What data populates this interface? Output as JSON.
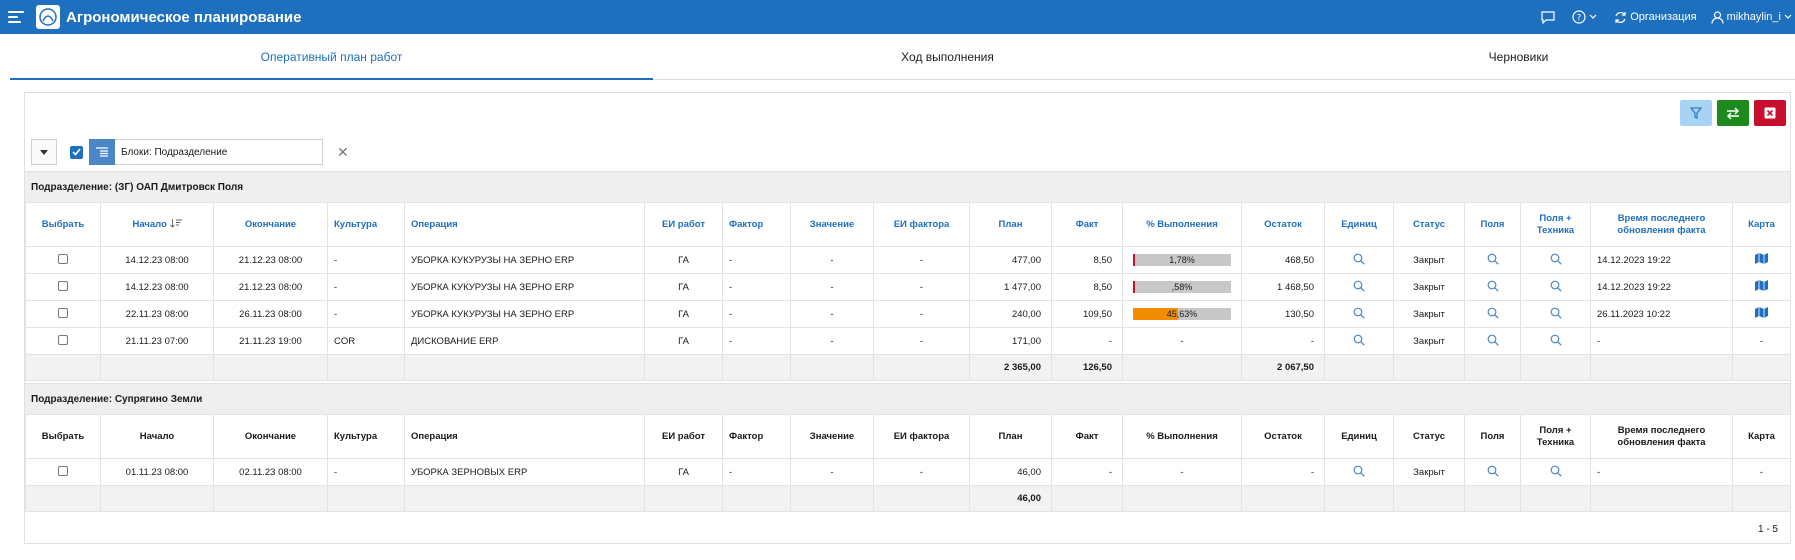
{
  "header": {
    "title": "Агрономическое планирование",
    "org_label": "Организация",
    "user": "mikhaylin_i"
  },
  "tabs": [
    {
      "label": "Оперативный план работ",
      "active": true
    },
    {
      "label": "Ход выполнения",
      "active": false
    },
    {
      "label": "Черновики",
      "active": false
    }
  ],
  "filter": {
    "label": "Блоки: Подразделение"
  },
  "columns": [
    "Выбрать",
    "Начало",
    "Окончание",
    "Культура",
    "Операция",
    "ЕИ работ",
    "Фактор",
    "Значение",
    "ЕИ фактора",
    "План",
    "Факт",
    "% Выполнения",
    "Остаток",
    "Единиц",
    "Статус",
    "Поля",
    "Поля + Техника",
    "Время последнего обновления факта",
    "Карта"
  ],
  "colors": {
    "accent": "#1f6fbf",
    "bar_red": "#c8102e",
    "bar_orange": "#f28c00"
  },
  "groups": [
    {
      "title": "Подразделение: (ЗГ) ОАП Дмитровск Поля",
      "rows": [
        {
          "start": "14.12.23 08:00",
          "end": "21.12.23 08:00",
          "crop": "-",
          "op": "УБОРКА КУКУРУЗЫ НА ЗЕРНО ERP",
          "unit": "ГА",
          "factor": "-",
          "value": "-",
          "factor_unit": "-",
          "plan": "477,00",
          "fact": "8,50",
          "pct_text": "1,78%",
          "pct": 0.0178,
          "pct_color": "#c8102e",
          "rest": "468,50",
          "status": "Закрыт",
          "updated": "14.12.2023 19:22",
          "map": true
        },
        {
          "start": "14.12.23 08:00",
          "end": "21.12.23 08:00",
          "crop": "-",
          "op": "УБОРКА КУКУРУЗЫ НА ЗЕРНО ERP",
          "unit": "ГА",
          "factor": "-",
          "value": "-",
          "factor_unit": "-",
          "plan": "1 477,00",
          "fact": "8,50",
          "pct_text": ",58%",
          "pct": 0.0058,
          "pct_color": "#c8102e",
          "rest": "1 468,50",
          "status": "Закрыт",
          "updated": "14.12.2023 19:22",
          "map": true
        },
        {
          "start": "22.11.23 08:00",
          "end": "26.11.23 08:00",
          "crop": "-",
          "op": "УБОРКА КУКУРУЗЫ НА ЗЕРНО ERP",
          "unit": "ГА",
          "factor": "-",
          "value": "-",
          "factor_unit": "-",
          "plan": "240,00",
          "fact": "109,50",
          "pct_text": "45,63%",
          "pct": 0.4563,
          "pct_color": "#f28c00",
          "rest": "130,50",
          "status": "Закрыт",
          "updated": "26.11.2023 10:22",
          "map": true
        },
        {
          "start": "21.11.23 07:00",
          "end": "21.11.23 19:00",
          "crop": "COR",
          "op": "ДИСКОВАНИЕ ERP",
          "unit": "ГА",
          "factor": "-",
          "value": "-",
          "factor_unit": "-",
          "plan": "171,00",
          "fact": "-",
          "pct_text": "-",
          "pct": null,
          "pct_color": "",
          "rest": "-",
          "status": "Закрыт",
          "updated": "-",
          "map": false
        }
      ],
      "totals": {
        "plan": "2 365,00",
        "fact": "126,50",
        "rest": "2 067,50"
      }
    },
    {
      "title": "Подразделение: Супрягино Земли",
      "rows": [
        {
          "start": "01.11.23 08:00",
          "end": "02.11.23 08:00",
          "crop": "-",
          "op": "УБОРКА ЗЕРНОВЫХ ERP",
          "unit": "ГА",
          "factor": "-",
          "value": "-",
          "factor_unit": "-",
          "plan": "46,00",
          "fact": "-",
          "pct_text": "-",
          "pct": null,
          "pct_color": "",
          "rest": "-",
          "status": "Закрыт",
          "updated": "-",
          "map": false
        }
      ],
      "totals": {
        "plan": "46,00",
        "fact": "",
        "rest": ""
      }
    }
  ],
  "pager": "1 - 5",
  "dash": "-"
}
